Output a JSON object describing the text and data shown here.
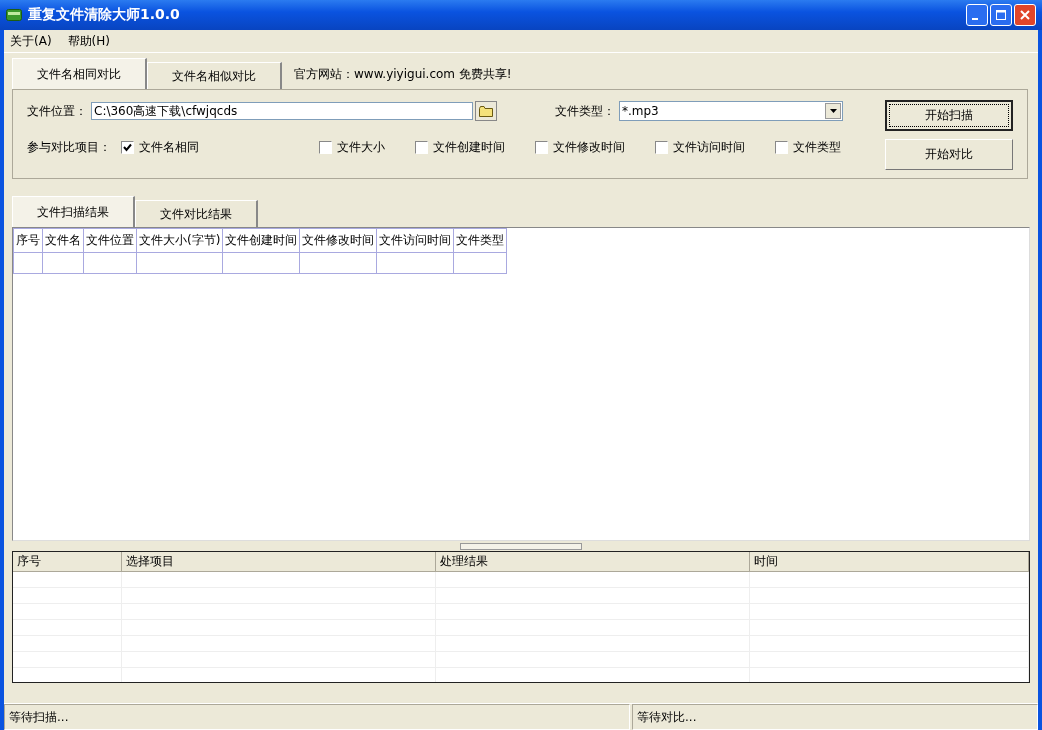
{
  "window": {
    "title": "重复文件清除大师1.0.0"
  },
  "menu": [
    {
      "label": "关于(A)"
    },
    {
      "label": "帮助(H)"
    }
  ],
  "top_tabs": [
    {
      "label": "文件名相同对比",
      "selected": true
    },
    {
      "label": "文件名相似对比",
      "selected": false
    }
  ],
  "website_note": "官方网站：www.yiyigui.com 免费共享!",
  "options": {
    "path_label": "文件位置：",
    "path_value": "C:\\360高速下载\\cfwjqcds",
    "type_label": "文件类型：",
    "type_value": "*.mp3",
    "compare_label": "参与对比项目：",
    "checkboxes": [
      {
        "label": "文件名相同",
        "checked": true
      },
      {
        "label": "文件大小",
        "checked": false
      },
      {
        "label": "文件创建时间",
        "checked": false
      },
      {
        "label": "文件修改时间",
        "checked": false
      },
      {
        "label": "文件访问时间",
        "checked": false
      },
      {
        "label": "文件类型",
        "checked": false
      }
    ]
  },
  "buttons": [
    {
      "label": "开始扫描",
      "focused": true
    },
    {
      "label": "开始对比",
      "focused": false
    }
  ],
  "result_tabs": [
    {
      "label": "文件扫描结果",
      "selected": true
    },
    {
      "label": "文件对比结果",
      "selected": false
    }
  ],
  "scan_table": {
    "columns": [
      "序号",
      "文件名",
      "文件位置",
      "文件大小(字节)",
      "文件创建时间",
      "文件修改时间",
      "文件访问时间",
      "文件类型"
    ]
  },
  "log_table": {
    "columns": [
      "序号",
      "选择项目",
      "处理结果",
      "时间"
    ]
  },
  "status_bar": [
    "等待扫描...",
    "等待对比..."
  ]
}
